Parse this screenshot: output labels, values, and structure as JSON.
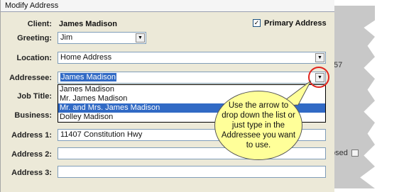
{
  "window": {
    "title": "Modify Address"
  },
  "form": {
    "client_label": "Client:",
    "client_value": "James Madison",
    "primary_label": "Primary Address",
    "primary_checked": "✓",
    "greeting_label": "Greeting:",
    "greeting_value": "Jim",
    "location_label": "Location:",
    "location_value": "Home Address",
    "addressee_label": "Addressee:",
    "addressee_value": "James Madison",
    "jobtitle_label": "Job Title:",
    "business_label": "Business:",
    "address1_label": "Address 1:",
    "address1_value": "11407 Constitution Hwy",
    "address2_label": "Address 2:",
    "address3_label": "Address 3:",
    "address2_value": ""
  },
  "dropdown": {
    "options": [
      "James Madison",
      "Mr. James Madison",
      "Mr. and Mrs. James Madison",
      "Dolley Madison"
    ],
    "highlighted_index": 2
  },
  "callout": {
    "text": "Use the arrow to drop down the list or just type in the Addressee you want to use."
  },
  "background": {
    "fragment_57": "57",
    "fragment_osed": "osed"
  },
  "colors": {
    "highlight": "#316ac5",
    "callout_fill": "#ffff99",
    "ring": "#e0231c"
  }
}
